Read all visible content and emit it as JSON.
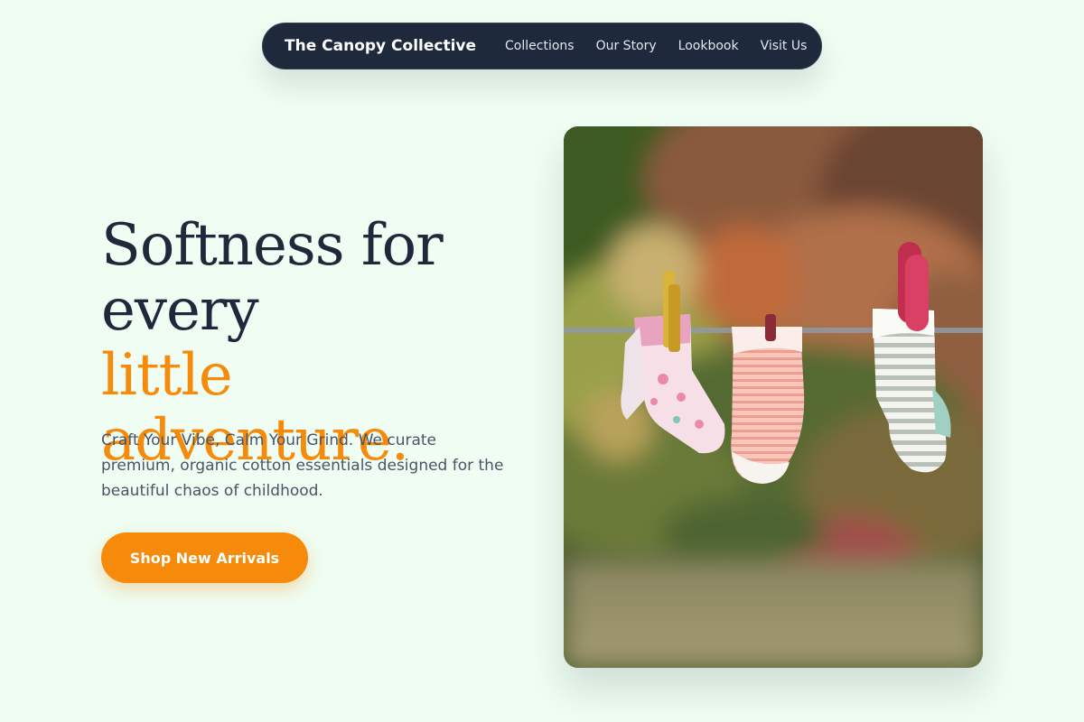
{
  "nav": {
    "brand": "The Canopy Collective",
    "links": [
      "Collections",
      "Our Story",
      "Lookbook",
      "Visit Us"
    ]
  },
  "hero": {
    "title_line1": "Softness for",
    "title_line2": "every",
    "title_accent": "little adventure.",
    "subtitle": "Craft Your Vibe, Calm Your Grind. We curate premium, organic cotton essentials designed for the beautiful chaos of childhood.",
    "cta_label": "Shop New Arrivals"
  },
  "image": {
    "subject": "baby socks hanging on a clothesline with clothespins, blurred garden background"
  },
  "colors": {
    "background": "#effdf2",
    "nav_bg": "#1e293b",
    "heading": "#1e293b",
    "accent": "#f58a0b",
    "body_text": "#475569"
  }
}
